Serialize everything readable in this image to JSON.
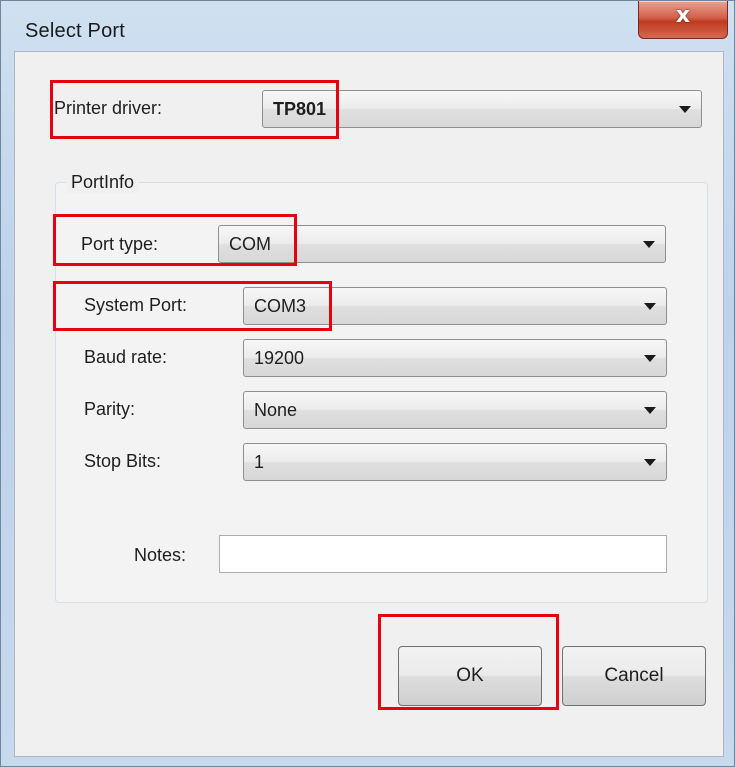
{
  "window": {
    "title": "Select Port",
    "close_glyph": "x"
  },
  "printer_driver": {
    "label": "Printer driver:",
    "value": "TP801"
  },
  "port_info": {
    "group_title": "PortInfo",
    "port_type": {
      "label": "Port type:",
      "value": "COM"
    },
    "system_port": {
      "label": "System Port:",
      "value": "COM3"
    },
    "baud_rate": {
      "label": "Baud rate:",
      "value": "19200"
    },
    "parity": {
      "label": "Parity:",
      "value": "None"
    },
    "stop_bits": {
      "label": "Stop Bits:",
      "value": "1"
    },
    "notes": {
      "label": "Notes:",
      "value": ""
    }
  },
  "buttons": {
    "ok": "OK",
    "cancel": "Cancel"
  },
  "colors": {
    "annotation": "#e8000e",
    "close_button": "#c8452c"
  },
  "icons": {
    "dropdown": "chevron-down-icon",
    "close": "close-icon"
  }
}
